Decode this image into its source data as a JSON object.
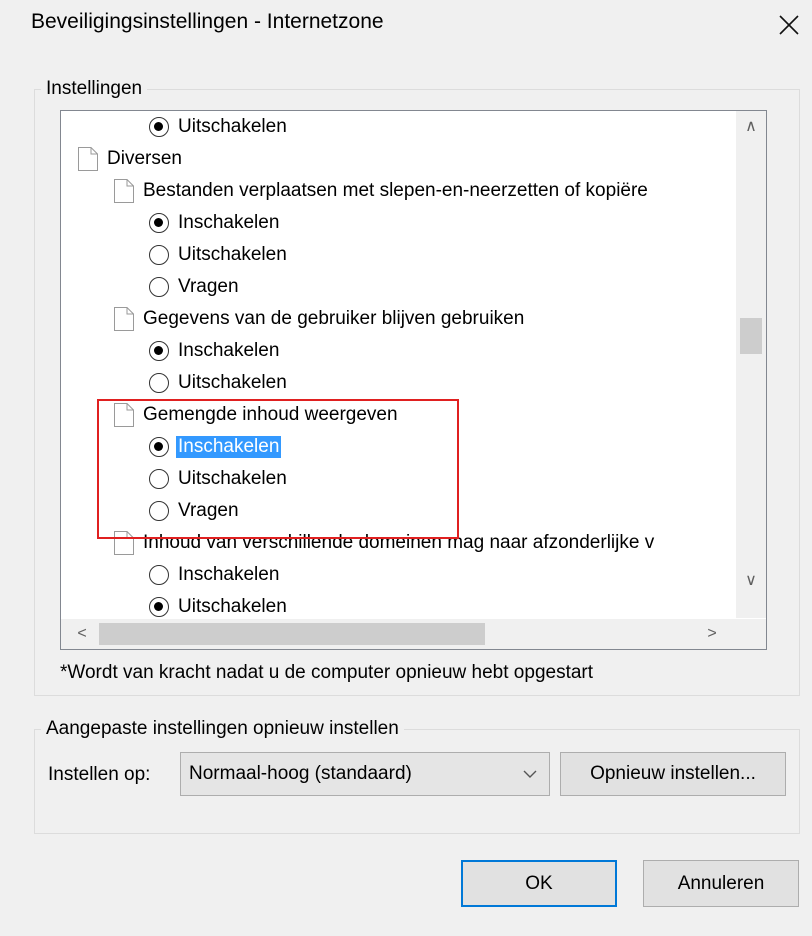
{
  "window": {
    "title": "Beveiligingsinstellingen - Internetzone",
    "close_icon": "close-icon"
  },
  "settings_group": {
    "legend": "Instellingen"
  },
  "tree": {
    "rows": [
      {
        "type": "radio",
        "text": "Uitschakelen",
        "checked": true
      },
      {
        "type": "category",
        "text": "Diversen"
      },
      {
        "type": "setting",
        "text": "Bestanden verplaatsen met slepen-en-neerzetten of kopiëre"
      },
      {
        "type": "radio",
        "text": "Inschakelen",
        "checked": true
      },
      {
        "type": "radio",
        "text": "Uitschakelen",
        "checked": false
      },
      {
        "type": "radio",
        "text": "Vragen",
        "checked": false
      },
      {
        "type": "setting",
        "text": "Gegevens van de gebruiker blijven gebruiken"
      },
      {
        "type": "radio",
        "text": "Inschakelen",
        "checked": true
      },
      {
        "type": "radio",
        "text": "Uitschakelen",
        "checked": false
      },
      {
        "type": "setting",
        "text": "Gemengde inhoud weergeven"
      },
      {
        "type": "radio",
        "text": "Inschakelen",
        "checked": true,
        "selected": true
      },
      {
        "type": "radio",
        "text": "Uitschakelen",
        "checked": false
      },
      {
        "type": "radio",
        "text": "Vragen",
        "checked": false
      },
      {
        "type": "setting",
        "text": "Inhoud van verschillende domeinen mag naar afzonderlijke v"
      },
      {
        "type": "radio",
        "text": "Inschakelen",
        "checked": false
      },
      {
        "type": "radio",
        "text": "Uitschakelen",
        "checked": true
      }
    ],
    "vertical_scroll_position": 0.42,
    "horizontal_scroll_position": 0.0
  },
  "note": "*Wordt van kracht nadat u de computer opnieuw hebt opgestart",
  "reset_group": {
    "legend": "Aangepaste instellingen opnieuw instellen",
    "label": "Instellen op:",
    "select_value": "Normaal-hoog (standaard)",
    "reset_button": "Opnieuw instellen..."
  },
  "buttons": {
    "ok": "OK",
    "cancel": "Annuleren"
  },
  "colors": {
    "selection": "#3399ff",
    "highlight_box": "#e02020",
    "default_button_border": "#0078d7"
  }
}
